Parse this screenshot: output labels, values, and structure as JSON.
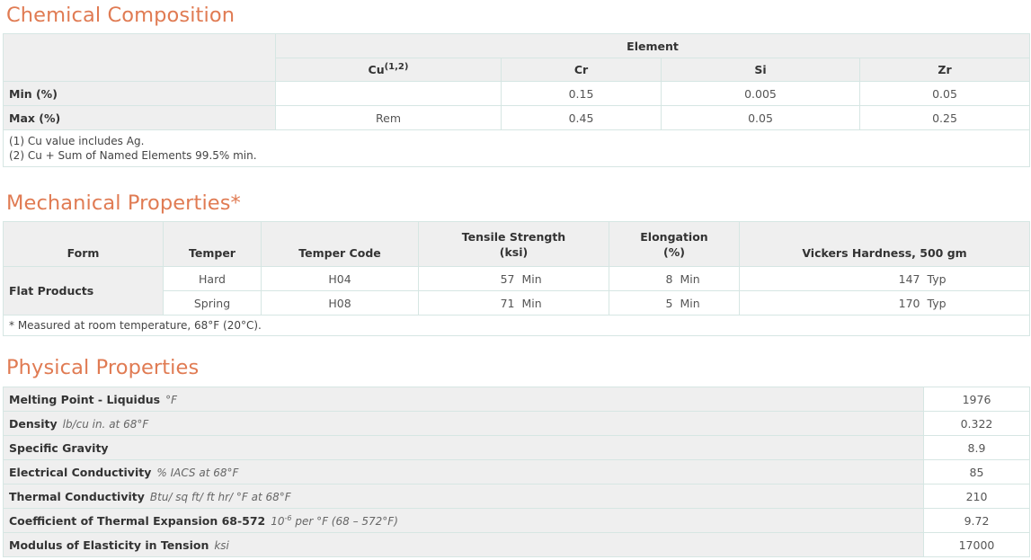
{
  "chemical": {
    "title": "Chemical Composition",
    "element_header": "Element",
    "columns": [
      {
        "name": "Cu",
        "sup": "(1,2)"
      },
      {
        "name": "Cr",
        "sup": ""
      },
      {
        "name": "Si",
        "sup": ""
      },
      {
        "name": "Zr",
        "sup": ""
      }
    ],
    "rows": [
      {
        "label": "Min (%)",
        "values": [
          "",
          "0.15",
          "0.005",
          "0.05"
        ]
      },
      {
        "label": "Max (%)",
        "values": [
          "Rem",
          "0.45",
          "0.05",
          "0.25"
        ]
      }
    ],
    "notes": [
      "(1) Cu value includes Ag.",
      "(2) Cu + Sum of Named Elements 99.5% min."
    ]
  },
  "mechanical": {
    "title": "Mechanical Properties*",
    "headers": {
      "form": "Form",
      "temper": "Temper",
      "temper_code": "Temper Code",
      "tensile": "Tensile Strength",
      "tensile_unit": "(ksi)",
      "elongation": "Elongation",
      "elongation_unit": "(%)",
      "hardness": "Vickers Hardness, 500 gm"
    },
    "form": "Flat Products",
    "rows": [
      {
        "temper": "Hard",
        "code": "H04",
        "tensile": "57",
        "tensile_q": "Min",
        "elong": "8",
        "elong_q": "Min",
        "hard": "147",
        "hard_q": "Typ"
      },
      {
        "temper": "Spring",
        "code": "H08",
        "tensile": "71",
        "tensile_q": "Min",
        "elong": "5",
        "elong_q": "Min",
        "hard": "170",
        "hard_q": "Typ"
      }
    ],
    "note": "* Measured at room temperature, 68°F (20°C)."
  },
  "physical": {
    "title": "Physical Properties",
    "rows": [
      {
        "label": "Melting Point - Liquidus",
        "unit": "°F",
        "value": "1976"
      },
      {
        "label": "Density",
        "unit": "lb/cu in. at 68°F",
        "value": "0.322"
      },
      {
        "label": "Specific Gravity",
        "unit": "",
        "value": "8.9"
      },
      {
        "label": "Electrical Conductivity",
        "unit": "% IACS at 68°F",
        "value": "85"
      },
      {
        "label": "Thermal Conductivity",
        "unit": "Btu/ sq ft/ ft hr/ °F at 68°F",
        "value": "210"
      },
      {
        "label": "Coefficient of Thermal Expansion 68-572",
        "unit_prefix": "10",
        "unit_sup": "-6",
        "unit": "per °F (68 – 572°F)",
        "value": "9.72"
      },
      {
        "label": "Modulus of Elasticity in Tension",
        "unit": "ksi",
        "value": "17000"
      }
    ]
  }
}
